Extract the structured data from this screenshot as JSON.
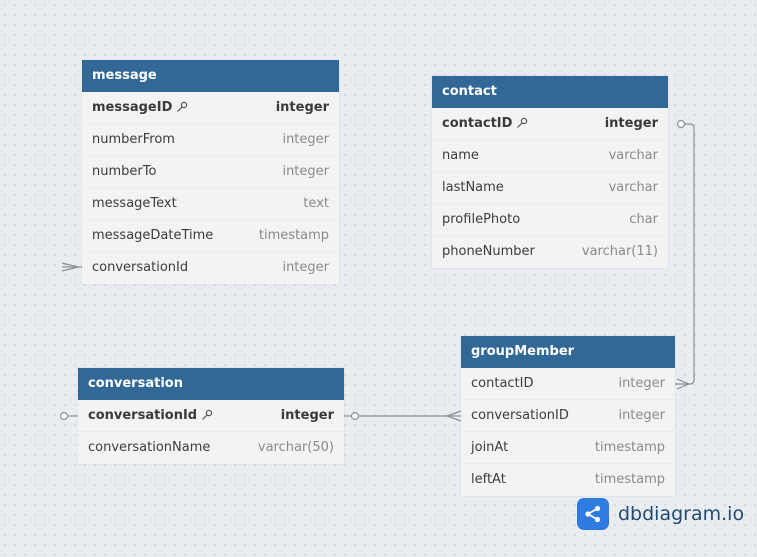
{
  "tables": {
    "message": {
      "name": "message",
      "fields": [
        {
          "name": "messageID",
          "type": "integer",
          "pk": true
        },
        {
          "name": "numberFrom",
          "type": "integer"
        },
        {
          "name": "numberTo",
          "type": "integer"
        },
        {
          "name": "messageText",
          "type": "text"
        },
        {
          "name": "messageDateTime",
          "type": "timestamp"
        },
        {
          "name": "conversationId",
          "type": "integer"
        }
      ]
    },
    "contact": {
      "name": "contact",
      "fields": [
        {
          "name": "contactID",
          "type": "integer",
          "pk": true
        },
        {
          "name": "name",
          "type": "varchar"
        },
        {
          "name": "lastName",
          "type": "varchar"
        },
        {
          "name": "profilePhoto",
          "type": "char"
        },
        {
          "name": "phoneNumber",
          "type": "varchar(11)"
        }
      ]
    },
    "conversation": {
      "name": "conversation",
      "fields": [
        {
          "name": "conversationId",
          "type": "integer",
          "pk": true
        },
        {
          "name": "conversationName",
          "type": "varchar(50)"
        }
      ]
    },
    "groupMember": {
      "name": "groupMember",
      "fields": [
        {
          "name": "contactID",
          "type": "integer"
        },
        {
          "name": "conversationID",
          "type": "integer"
        },
        {
          "name": "joinAt",
          "type": "timestamp"
        },
        {
          "name": "leftAt",
          "type": "timestamp"
        }
      ]
    }
  },
  "brand": {
    "text": "dbdiagram.io",
    "color": "#2f7be0"
  },
  "colors": {
    "header": "#316896",
    "body": "#f3f3f3",
    "line": "#8c9196"
  }
}
